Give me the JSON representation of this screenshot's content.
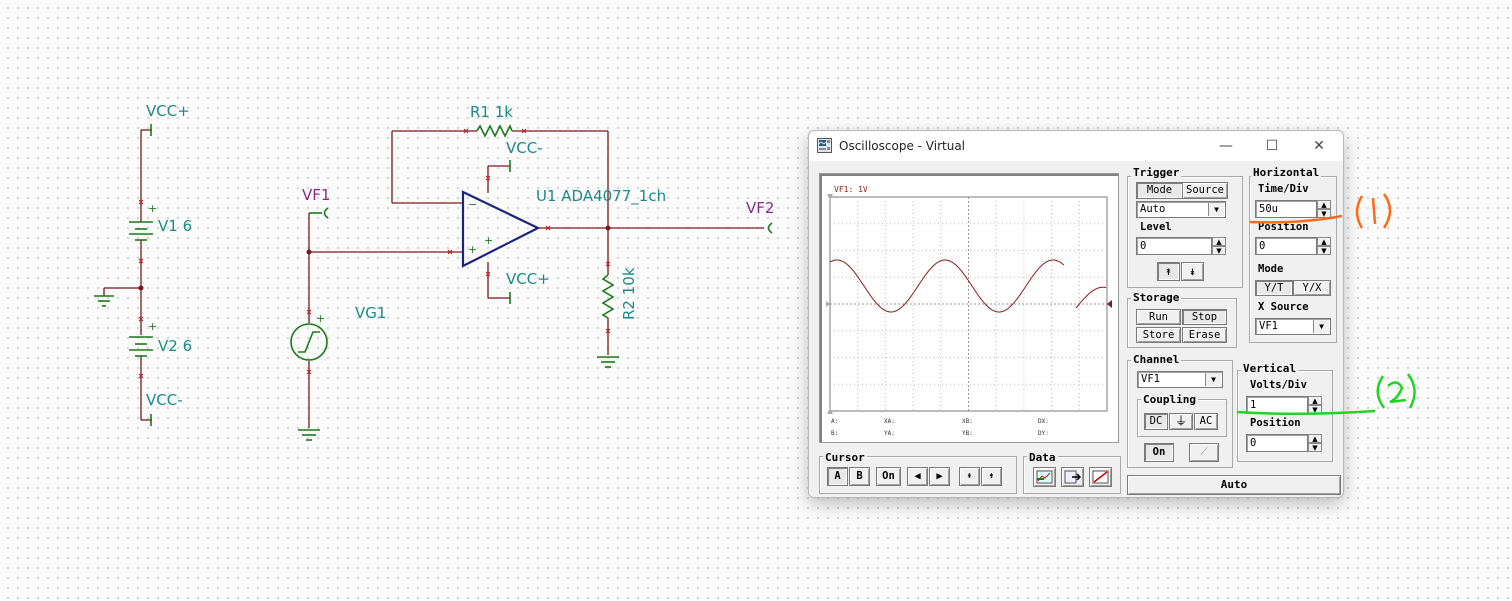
{
  "schematic": {
    "vcc_plus_top": "VCC+",
    "v1_label": "V1 6",
    "v2_label": "V2 6",
    "vcc_minus_bottom": "VCC-",
    "vf1_label": "VF1",
    "vg1_label": "VG1",
    "r1_label": "R1 1k",
    "opamp_vcc_minus": "VCC-",
    "opamp_vcc_plus": "VCC+",
    "u1_label": "U1 ADA4077_1ch",
    "vf2_label": "VF2",
    "r2_label": "R2 10k"
  },
  "oscilloscope": {
    "title": "Oscilloscope - Virtual",
    "window_controls": {
      "minimize": "—",
      "maximize": "☐",
      "close": "✕"
    },
    "screen": {
      "channel_label": "VF1: 1V",
      "readouts": {
        "a": "A:",
        "b": "B:",
        "xa": "XA:",
        "ya": "YA:",
        "xb": "XB:",
        "yb": "YB:",
        "dx": "DX:",
        "dy": "DY:"
      },
      "trace_color": "#8b1a1a"
    },
    "trigger": {
      "title": "Trigger",
      "mode_btn": "Mode",
      "source_btn": "Source",
      "mode_value": "Auto",
      "level_label": "Level",
      "level_value": "0"
    },
    "horizontal": {
      "title": "Horizontal",
      "time_div_label": "Time/Div",
      "time_div_value": "50u",
      "position_label": "Position",
      "position_value": "0",
      "mode_label": "Mode",
      "yt_btn": "Y/T",
      "yx_btn": "Y/X",
      "x_source_label": "X Source",
      "x_source_value": "VF1"
    },
    "storage": {
      "title": "Storage",
      "run": "Run",
      "stop": "Stop",
      "store": "Store",
      "erase": "Erase"
    },
    "channel": {
      "title": "Channel",
      "value": "VF1",
      "coupling_title": "Coupling",
      "dc": "DC",
      "ac": "AC",
      "on_btn": "On"
    },
    "vertical": {
      "title": "Vertical",
      "volts_div_label": "Volts/Div",
      "volts_div_value": "1",
      "position_label": "Position",
      "position_value": "0"
    },
    "cursor": {
      "title": "Cursor",
      "a": "A",
      "b": "B",
      "on": "On"
    },
    "data": {
      "title": "Data"
    },
    "auto_btn": "Auto"
  },
  "annotations": {
    "mark1_color": "#ff6a1a",
    "mark2_color": "#22d422"
  }
}
